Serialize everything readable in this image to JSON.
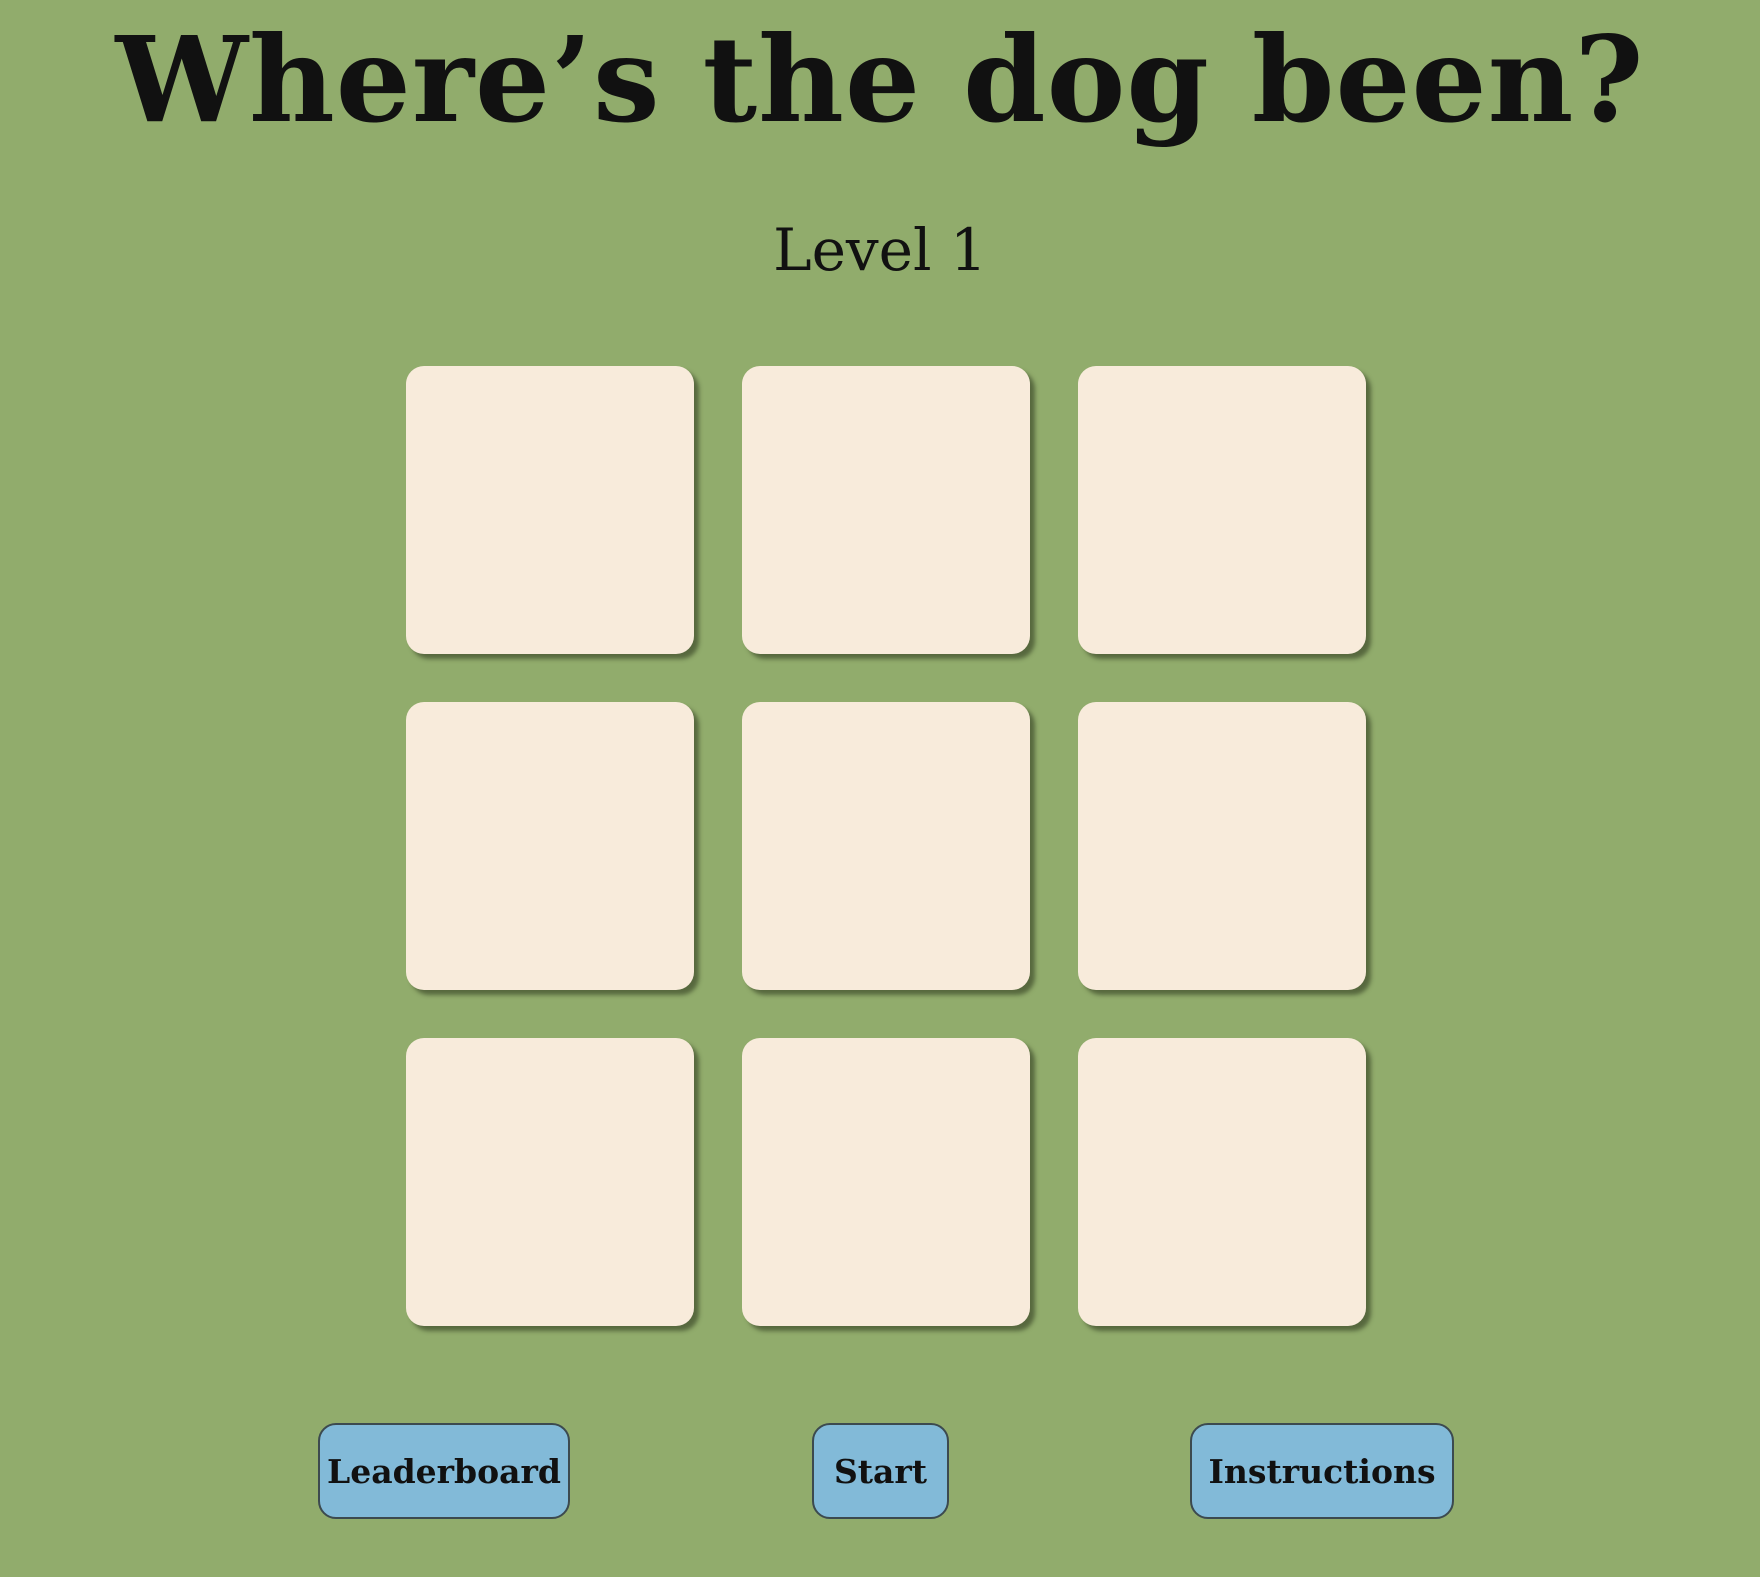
{
  "header": {
    "title": "Where’s the dog been?",
    "level": "Level 1"
  },
  "board": {
    "rows": 3,
    "columns": 3,
    "tile_color": "#f8ebdb"
  },
  "controls": {
    "leaderboard_label": "Leaderboard",
    "start_label": "Start",
    "instructions_label": "Instructions",
    "button_color": "#82bad8"
  },
  "theme": {
    "background": "#91ac6c"
  }
}
